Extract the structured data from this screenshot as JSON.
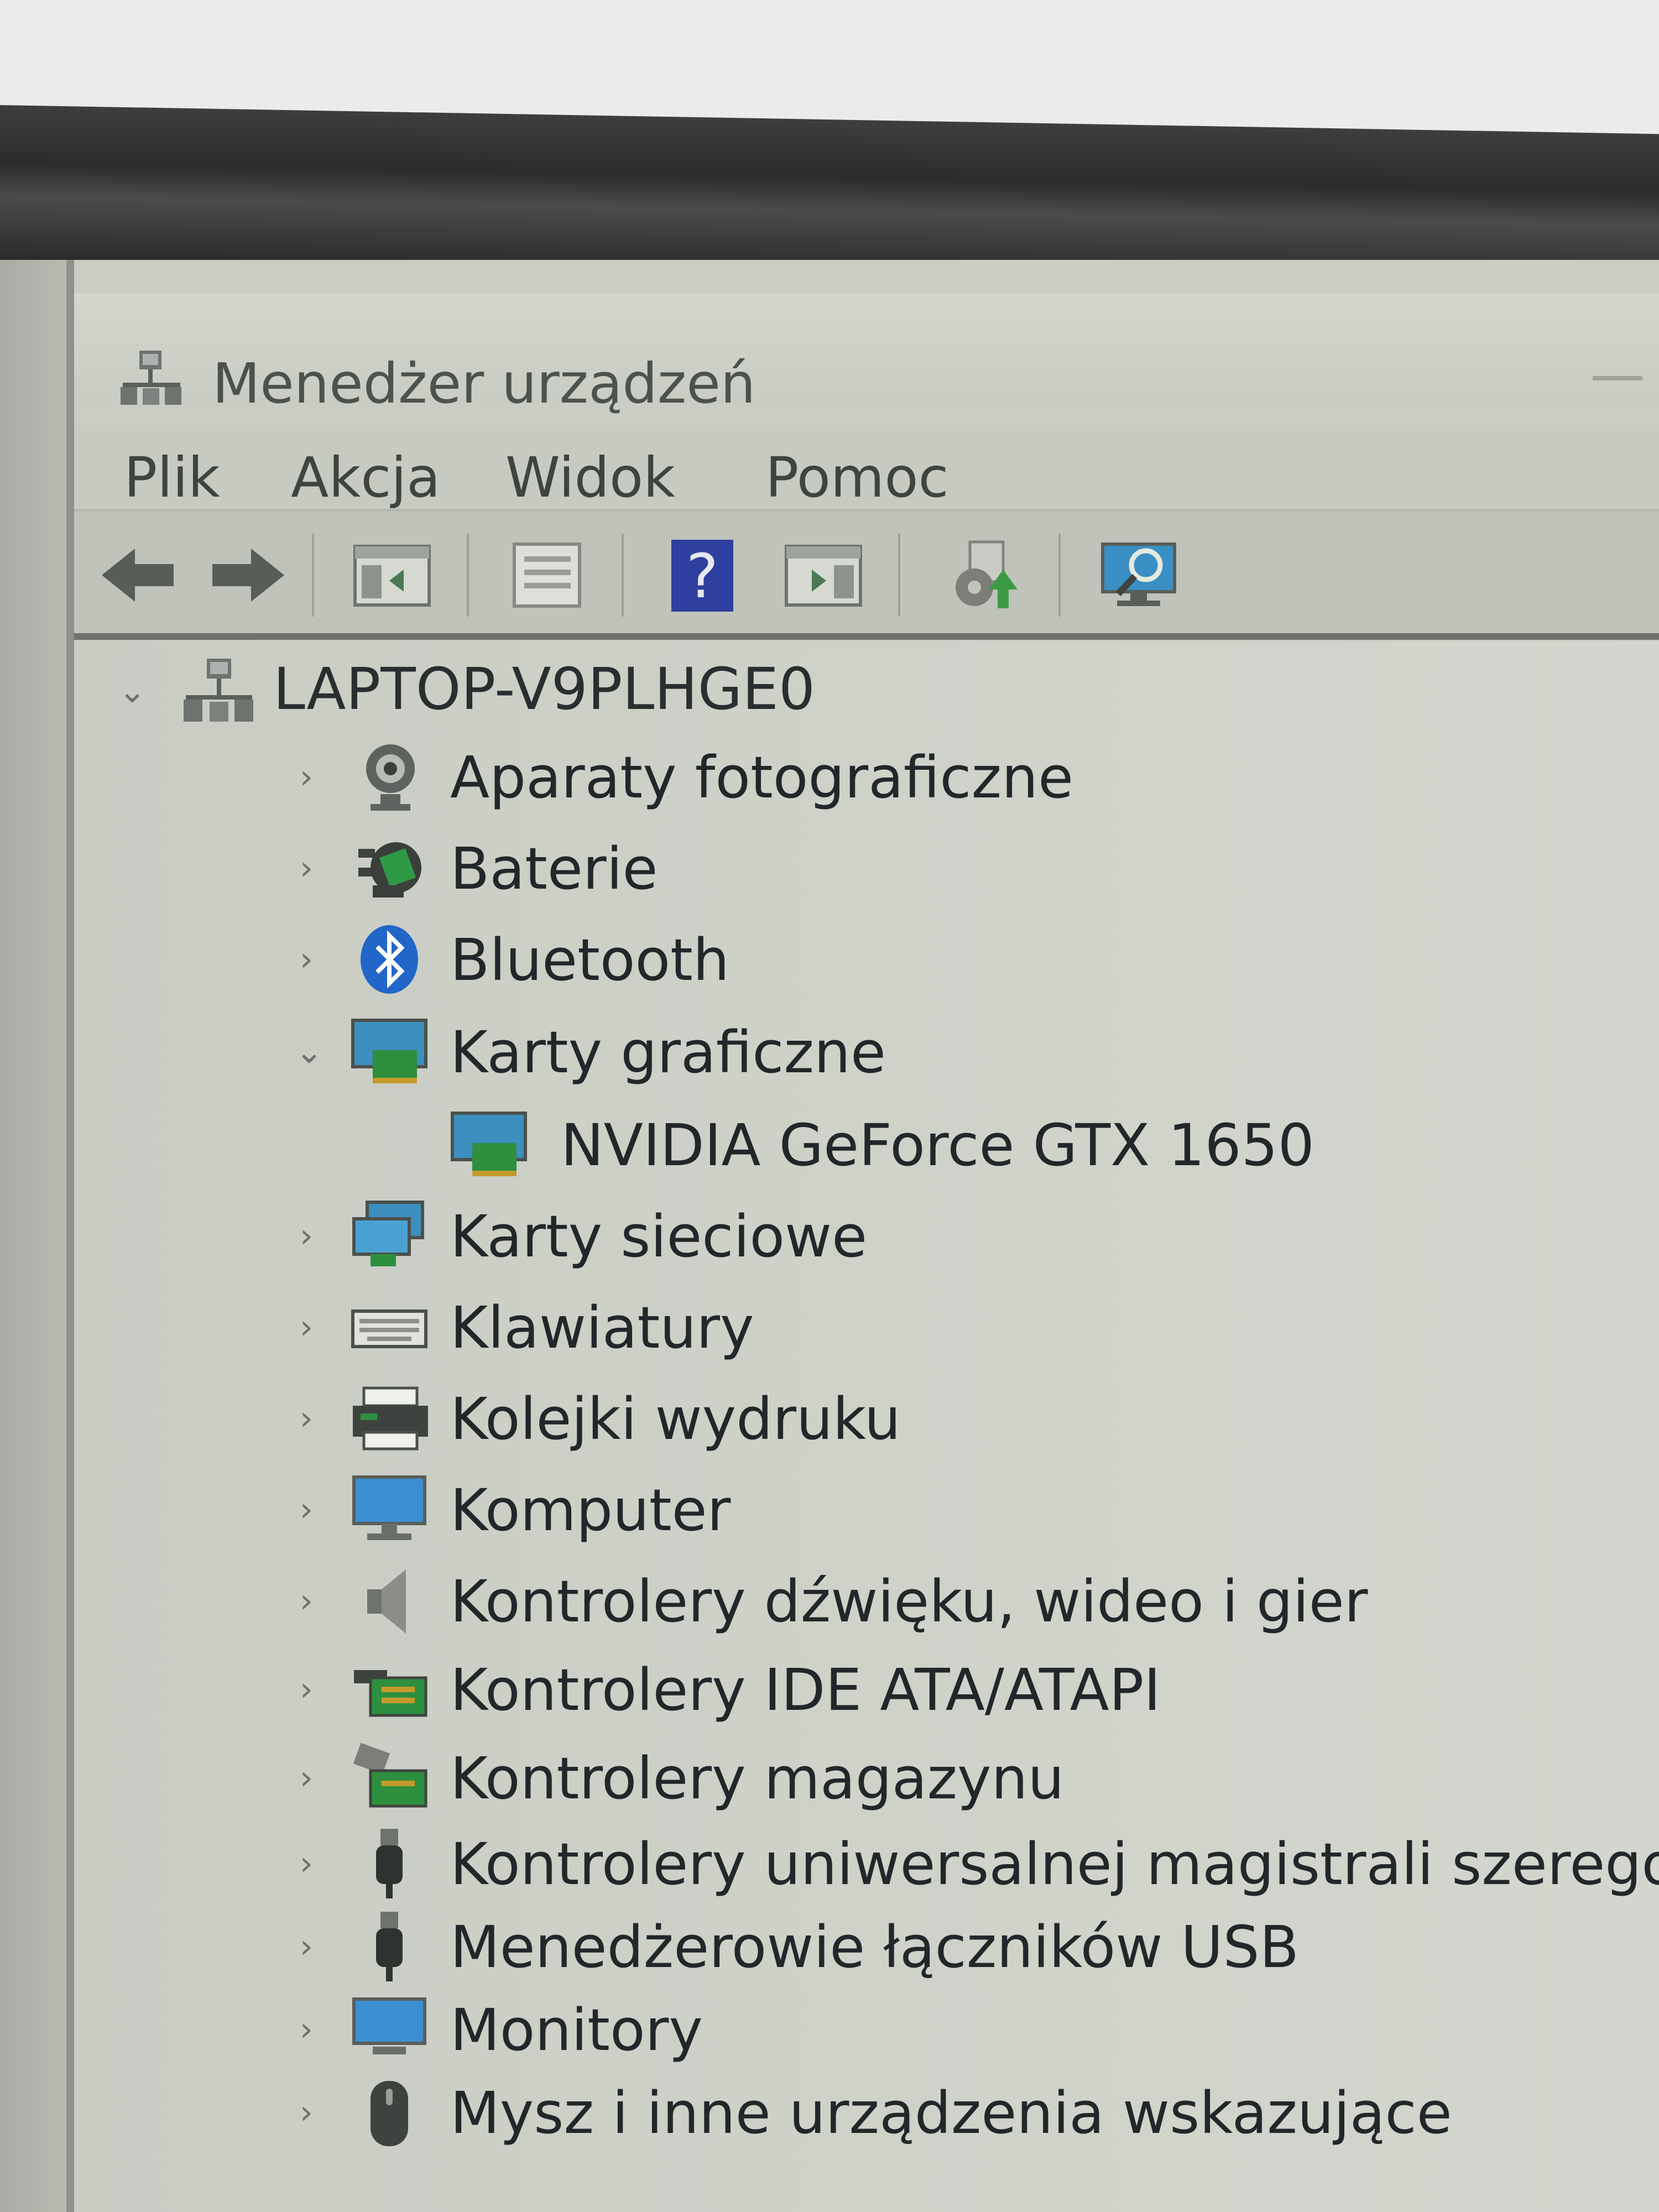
{
  "window": {
    "title": "Menedżer urządzeń"
  },
  "menu": [
    "Plik",
    "Akcja",
    "Widok",
    "Pomoc"
  ],
  "toolbar": {
    "buttons": [
      "back-arrow-icon",
      "forward-arrow-icon",
      "show-hide-console-tree-icon",
      "properties-icon",
      "help-icon",
      "show-action-pane-icon",
      "update-driver-icon",
      "scan-hardware-changes-icon"
    ]
  },
  "tree": {
    "root": "LAPTOP-V9PLHGE0",
    "categories": [
      {
        "label": "Aparaty fotograficzne",
        "icon": "camera-icon",
        "expanded": false
      },
      {
        "label": "Baterie",
        "icon": "battery-icon",
        "expanded": false
      },
      {
        "label": "Bluetooth",
        "icon": "bluetooth-icon",
        "expanded": false
      },
      {
        "label": "Karty graficzne",
        "icon": "display-adapter-icon",
        "expanded": true
      },
      {
        "label": "Karty sieciowe",
        "icon": "network-adapter-icon",
        "expanded": false
      },
      {
        "label": "Klawiatury",
        "icon": "keyboard-icon",
        "expanded": false
      },
      {
        "label": "Kolejki wydruku",
        "icon": "printer-icon",
        "expanded": false
      },
      {
        "label": "Komputer",
        "icon": "computer-icon",
        "expanded": false
      },
      {
        "label": "Kontrolery dźwięku, wideo i gier",
        "icon": "speaker-icon",
        "expanded": false
      },
      {
        "label": "Kontrolery IDE ATA/ATAPI",
        "icon": "ide-controller-icon",
        "expanded": false
      },
      {
        "label": "Kontrolery magazynu",
        "icon": "storage-controller-icon",
        "expanded": false
      },
      {
        "label": "Kontrolery uniwersalnej magistrali szeregowej",
        "icon": "usb-icon",
        "expanded": false
      },
      {
        "label": "Menedżerowie łączników USB",
        "icon": "usb-connector-icon",
        "expanded": false
      },
      {
        "label": "Monitory",
        "icon": "monitor-icon",
        "expanded": false
      },
      {
        "label": "Mysz i inne urządzenia wskazujące",
        "icon": "mouse-icon",
        "expanded": false
      }
    ],
    "devices": {
      "karty_graficzne": "NVIDIA GeForce GTX 1650"
    }
  }
}
